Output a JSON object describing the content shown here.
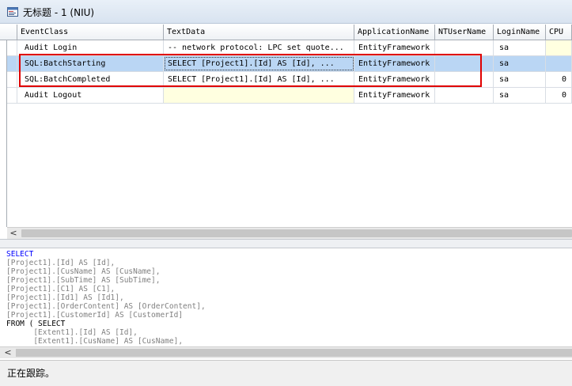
{
  "window": {
    "title": "无标题 - 1 (NIU)"
  },
  "grid": {
    "columns": [
      "EventClass",
      "TextData",
      "ApplicationName",
      "NTUserName",
      "LoginName",
      "CPU"
    ],
    "rows": [
      {
        "event": "Audit Login",
        "text": "-- network protocol: LPC  set quote...",
        "app": "EntityFramework",
        "nt": "",
        "login": "sa",
        "cpu": "",
        "selected": false
      },
      {
        "event": "SQL:BatchStarting",
        "text": "SELECT   [Project1].[Id] AS [Id],  ...",
        "app": "EntityFramework",
        "nt": "",
        "login": "sa",
        "cpu": "",
        "selected": true
      },
      {
        "event": "SQL:BatchCompleted",
        "text": "SELECT   [Project1].[Id] AS [Id],  ...",
        "app": "EntityFramework",
        "nt": "",
        "login": "sa",
        "cpu": "0",
        "selected": false
      },
      {
        "event": "Audit Logout",
        "text": "",
        "app": "EntityFramework",
        "nt": "",
        "login": "sa",
        "cpu": "0",
        "selected": false
      }
    ]
  },
  "sql_pane": {
    "lines": [
      {
        "kw": "SELECT",
        "rest": ""
      },
      {
        "kw": "",
        "rest": "[Project1].[Id] AS [Id],"
      },
      {
        "kw": "",
        "rest": "[Project1].[CusName] AS [CusName],"
      },
      {
        "kw": "",
        "rest": "[Project1].[SubTime] AS [SubTime],"
      },
      {
        "kw": "",
        "rest": "[Project1].[C1] AS [C1],"
      },
      {
        "kw": "",
        "rest": "[Project1].[Id1] AS [Id1],"
      },
      {
        "kw": "",
        "rest": "[Project1].[OrderContent] AS [OrderContent],"
      },
      {
        "kw": "",
        "rest": "[Project1].[CustomerId] AS [CustomerId]"
      },
      {
        "kw": "FROM ( SELECT",
        "rest": ""
      },
      {
        "kw": "",
        "rest": "      [Extent1].[Id] AS [Id],"
      },
      {
        "kw": "",
        "rest": "      [Extent1].[CusName] AS [CusName],"
      }
    ]
  },
  "status": {
    "text": "正在跟踪。"
  },
  "icons": {
    "window_icon": "trace-window-icon",
    "scroll_left": "scroll-left-arrow-icon"
  },
  "colors": {
    "selected_row": "#bad6f4",
    "highlight_box": "#e00000",
    "sql_keyword": "#0000ff"
  }
}
